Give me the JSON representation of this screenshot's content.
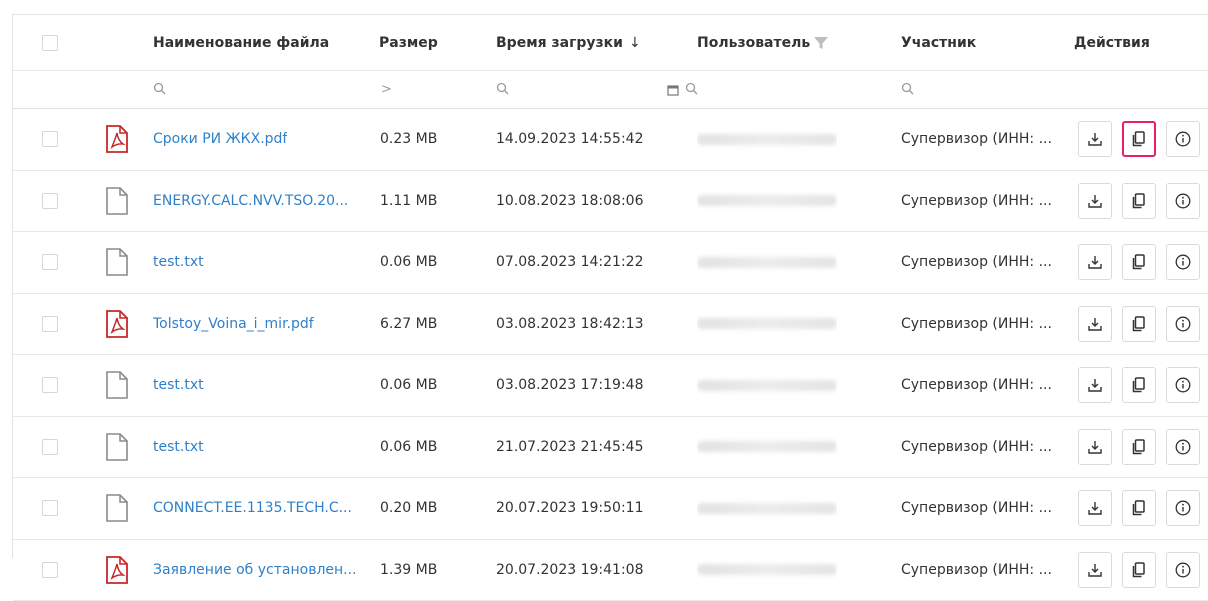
{
  "header": {
    "col_name": "Наименование файла",
    "col_size": "Размер",
    "col_time": "Время загрузки",
    "col_time_sort": "↓",
    "col_user": "Пользователь",
    "col_participant": "Участник",
    "col_actions": "Действия"
  },
  "filter": {
    "size_operator": ">"
  },
  "rows": [
    {
      "type": "pdf",
      "name": "Сроки РИ ЖКХ.pdf",
      "size": "0.23 MB",
      "time": "14.09.2023 14:55:42",
      "participant": "Супервизор (ИНН: ..."
    },
    {
      "type": "doc",
      "name": "ENERGY.CALC.NVV.TSO.20...",
      "size": "1.11 MB",
      "time": "10.08.2023 18:08:06",
      "participant": "Супервизор (ИНН: ..."
    },
    {
      "type": "doc",
      "name": "test.txt",
      "size": "0.06 MB",
      "time": "07.08.2023 14:21:22",
      "participant": "Супервизор (ИНН: ..."
    },
    {
      "type": "pdf",
      "name": "Tolstoy_Voina_i_mir.pdf",
      "size": "6.27 MB",
      "time": "03.08.2023 18:42:13",
      "participant": "Супервизор (ИНН: ..."
    },
    {
      "type": "doc",
      "name": "test.txt",
      "size": "0.06 MB",
      "time": "03.08.2023 17:19:48",
      "participant": "Супервизор (ИНН: ..."
    },
    {
      "type": "doc",
      "name": "test.txt",
      "size": "0.06 MB",
      "time": "21.07.2023 21:45:45",
      "participant": "Супервизор (ИНН: ..."
    },
    {
      "type": "doc",
      "name": "CONNECT.EE.1135.TECH.C...",
      "size": "0.20 MB",
      "time": "20.07.2023 19:50:11",
      "participant": "Супервизор (ИНН: ..."
    },
    {
      "type": "pdf",
      "name": "Заявление об установлен...",
      "size": "1.39 MB",
      "time": "20.07.2023 19:41:08",
      "participant": "Супервизор (ИНН: ..."
    }
  ],
  "icons": {
    "pdf": "pdf-file-icon",
    "doc": "file-icon",
    "download": "download-icon",
    "copy": "copy-icon",
    "info": "info-icon",
    "search": "search-icon",
    "calendar": "calendar-icon",
    "filter": "filter-icon"
  },
  "colors": {
    "link": "#2f80c9",
    "pdf_red": "#c62828",
    "highlight": "#e91e63",
    "border": "#e3e3e3"
  },
  "highlighted_action": {
    "row": 0,
    "action": "copy"
  }
}
